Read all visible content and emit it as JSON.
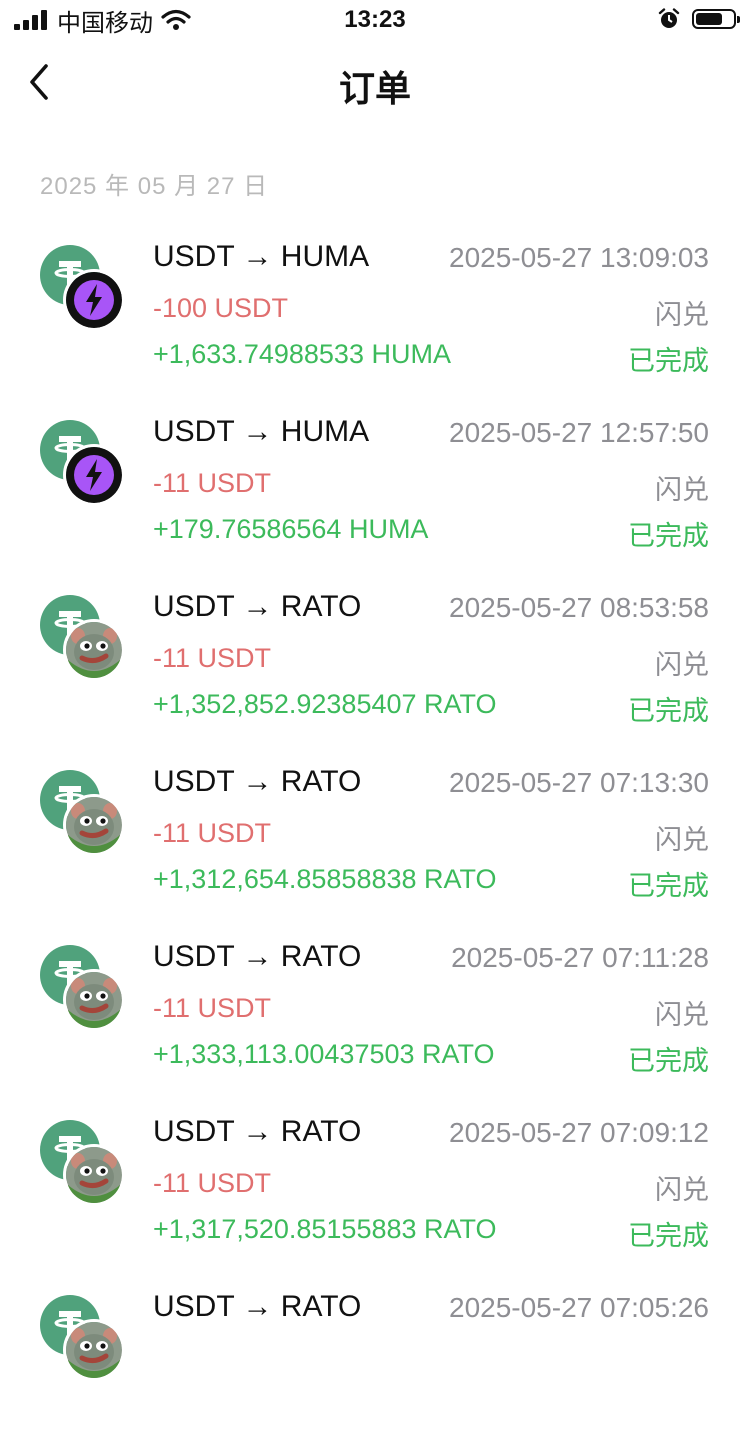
{
  "status_bar": {
    "carrier": "中国移动",
    "time": "13:23"
  },
  "nav": {
    "title": "订单"
  },
  "date_header": "2025 年 05 月 27 日",
  "colors": {
    "usdt_green": "#50a27c",
    "negative": "#e06f6f",
    "positive": "#3cba5b",
    "muted": "#8e8e93"
  },
  "orders": [
    {
      "pair": "USDT → HUMA",
      "time": "2025-05-27 13:09:03",
      "paid": "-100 USDT",
      "type": "闪兑",
      "received": "+1,633.74988533 HUMA",
      "status": "已完成",
      "to_icon": "huma-token-icon"
    },
    {
      "pair": "USDT → HUMA",
      "time": "2025-05-27 12:57:50",
      "paid": "-11 USDT",
      "type": "闪兑",
      "received": "+179.76586564 HUMA",
      "status": "已完成",
      "to_icon": "huma-token-icon"
    },
    {
      "pair": "USDT → RATO",
      "time": "2025-05-27 08:53:58",
      "paid": "-11 USDT",
      "type": "闪兑",
      "received": "+1,352,852.92385407 RATO",
      "status": "已完成",
      "to_icon": "rato-token-icon"
    },
    {
      "pair": "USDT → RATO",
      "time": "2025-05-27 07:13:30",
      "paid": "-11 USDT",
      "type": "闪兑",
      "received": "+1,312,654.85858838 RATO",
      "status": "已完成",
      "to_icon": "rato-token-icon"
    },
    {
      "pair": "USDT → RATO",
      "time": "2025-05-27 07:11:28",
      "paid": "-11 USDT",
      "type": "闪兑",
      "received": "+1,333,113.00437503 RATO",
      "status": "已完成",
      "to_icon": "rato-token-icon"
    },
    {
      "pair": "USDT → RATO",
      "time": "2025-05-27 07:09:12",
      "paid": "-11 USDT",
      "type": "闪兑",
      "received": "+1,317,520.85155883 RATO",
      "status": "已完成",
      "to_icon": "rato-token-icon"
    },
    {
      "pair": "USDT → RATO",
      "time": "2025-05-27 07:05:26",
      "paid": "",
      "type": "",
      "received": "",
      "status": "",
      "to_icon": "rato-token-icon"
    }
  ]
}
